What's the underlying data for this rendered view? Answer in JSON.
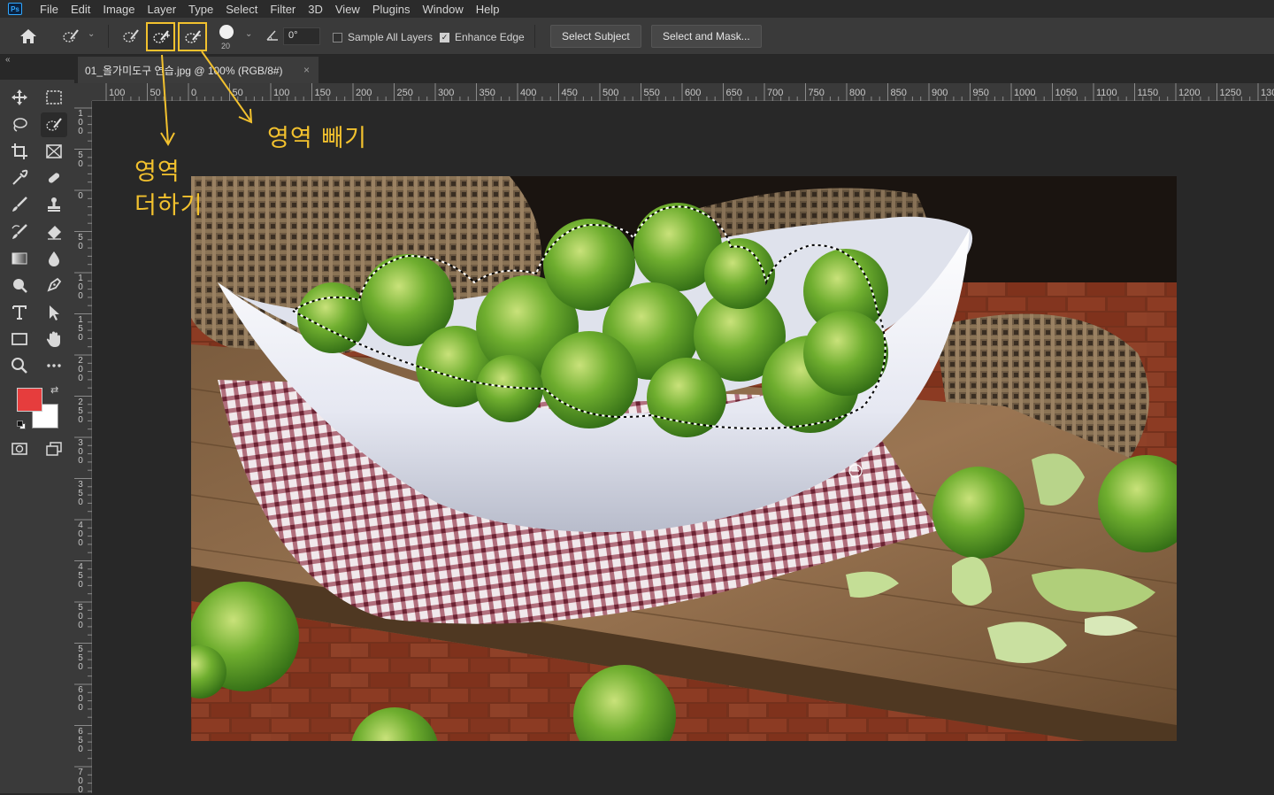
{
  "app": {
    "logo": "Ps"
  },
  "menu": [
    "File",
    "Edit",
    "Image",
    "Layer",
    "Type",
    "Select",
    "Filter",
    "3D",
    "View",
    "Plugins",
    "Window",
    "Help"
  ],
  "options": {
    "brush_size": "20",
    "angle": "0°",
    "sample_all_layers": "Sample All Layers",
    "sample_all_layers_checked": false,
    "enhance_edge": "Enhance Edge",
    "enhance_edge_checked": true,
    "select_subject": "Select Subject",
    "select_and_mask": "Select and Mask..."
  },
  "document_tab": {
    "title": "01_올가미도구 연습.jpg @ 100% (RGB/8#)",
    "close": "×"
  },
  "ruler_top": [
    "100",
    "50",
    "0",
    "50",
    "100",
    "150",
    "200",
    "250",
    "300",
    "350",
    "400",
    "450",
    "500",
    "550",
    "600",
    "650",
    "700",
    "750",
    "800",
    "850",
    "900",
    "950",
    "1000",
    "1050",
    "1100",
    "1150",
    "1200",
    "1250",
    "130"
  ],
  "ruler_left": [
    "1\n0\n0",
    "5\n0",
    "0",
    "5\n0",
    "1\n0\n0",
    "1\n5\n0",
    "2\n0\n0",
    "2\n5\n0",
    "3\n0\n0",
    "3\n5\n0",
    "4\n0\n0",
    "4\n5\n0",
    "5\n0\n0",
    "5\n5\n0",
    "6\n0\n0",
    "6\n5\n0",
    "7\n0\n0"
  ],
  "annotations": {
    "add_line1": "영역",
    "add_line2": "더하기",
    "subtract": "영역 빼기"
  },
  "colors": {
    "foreground": "#e63d3d",
    "background": "#ffffff",
    "highlight": "#f2c12e"
  }
}
